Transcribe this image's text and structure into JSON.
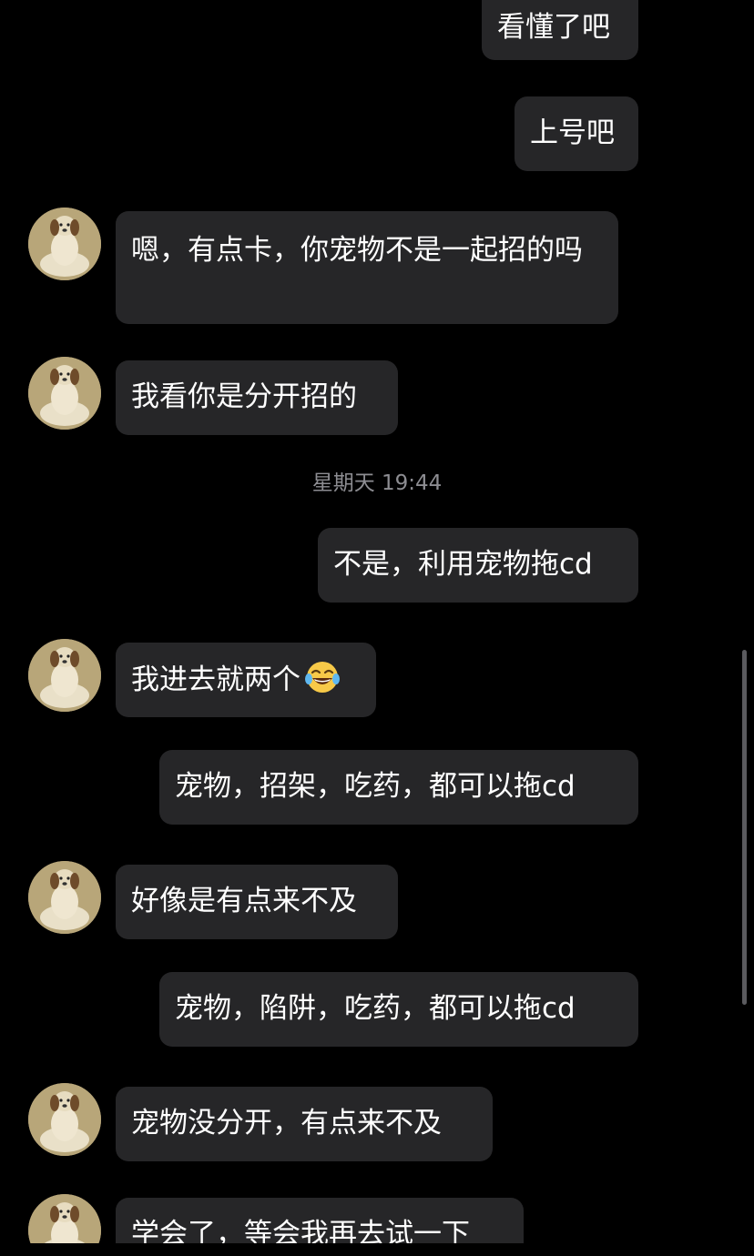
{
  "conversation": {
    "messages": [
      {
        "side": "sent",
        "text": "看懂了吧"
      },
      {
        "side": "sent",
        "text": "上号吧"
      },
      {
        "side": "received",
        "text": "嗯，有点卡，你宠物不是一起招的吗"
      },
      {
        "side": "received",
        "text": "我看你是分开招的"
      },
      {
        "side": "sent",
        "text": "不是，利用宠物拖cd"
      },
      {
        "side": "received",
        "text": "我进去就两个",
        "emoji": "face-with-tears-of-joy-icon"
      },
      {
        "side": "sent",
        "text": "宠物，招架，吃药，都可以拖cd"
      },
      {
        "side": "received",
        "text": "好像是有点来不及"
      },
      {
        "side": "sent",
        "text": "宠物，陷阱，吃药，都可以拖cd"
      },
      {
        "side": "received",
        "text": "宠物没分开，有点来不及"
      },
      {
        "side": "received",
        "text": "学会了，等会我再去试一下"
      }
    ],
    "timestamp": "星期天 19:44"
  },
  "colors": {
    "background": "#000000",
    "bubble": "#262628",
    "text": "#ffffff",
    "timestamp": "#8d8d92",
    "scrollbar": "#5b5b5f"
  }
}
